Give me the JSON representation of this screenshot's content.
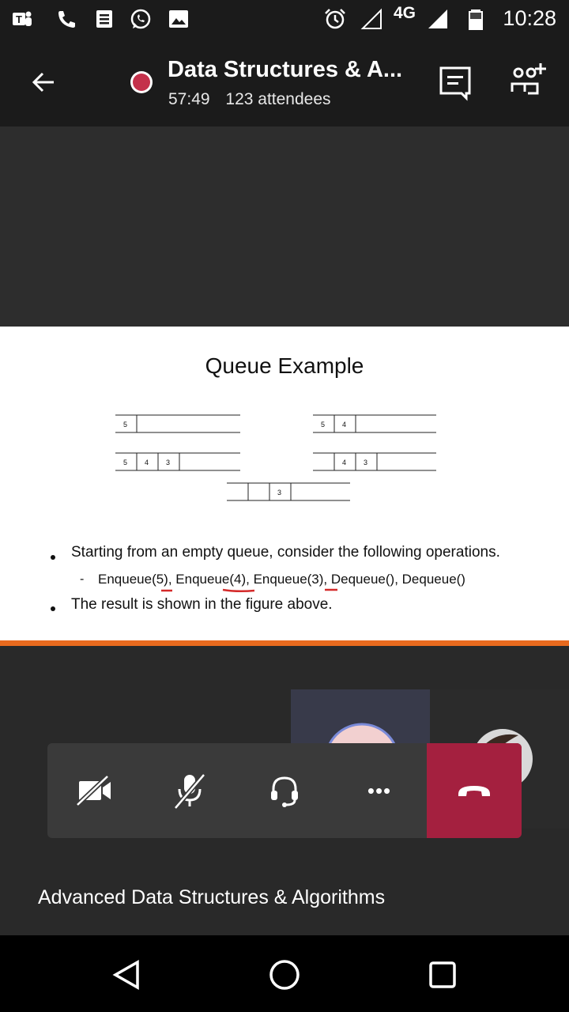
{
  "status_bar": {
    "time": "10:28",
    "network": "4G",
    "icons": [
      "teams-icon",
      "phone-icon",
      "notes-icon",
      "whatsapp-icon",
      "gallery-icon",
      "alarm-icon",
      "signal-icon",
      "battery-icon"
    ]
  },
  "header": {
    "title": "Data Structures & A...",
    "duration": "57:49",
    "attendees": "123 attendees",
    "recording_color": "#c4314b"
  },
  "slide": {
    "title": "Queue Example",
    "bullets": [
      "Starting from an empty queue, consider the following operations.",
      "Enqueue(5), Enqueue(4), Enqueue(3), Dequeue(), Dequeue()",
      "The result is shown in the figure above."
    ],
    "sub_marker": "-",
    "queues": [
      {
        "cells": [
          "5"
        ]
      },
      {
        "cells": [
          "5",
          "4"
        ]
      },
      {
        "cells": [
          "5",
          "4",
          "3"
        ]
      },
      {
        "cells": [
          "",
          "4",
          "3"
        ]
      },
      {
        "cells": [
          "",
          "",
          "3"
        ]
      }
    ],
    "accent_color": "#e86a1e"
  },
  "controls": {
    "items": [
      "camera-off",
      "mic-off",
      "audio",
      "more",
      "hang-up"
    ],
    "more_label": "•••",
    "hangup_color": "#a4203f"
  },
  "meeting_name": "Advanced Data Structures & Algorithms",
  "nav": {
    "items": [
      "back",
      "home",
      "recents"
    ]
  }
}
